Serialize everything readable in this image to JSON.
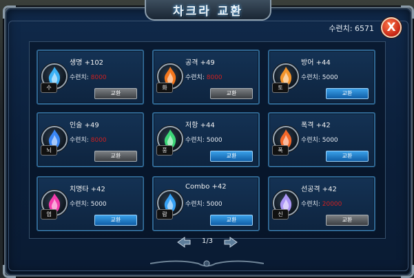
{
  "title": "차크라 교환",
  "points": {
    "label": "수련치:",
    "value": "6571"
  },
  "close_label": "X",
  "cost_label": "수련치:",
  "button_label": "교환",
  "cards": [
    {
      "stat": "생명 +102",
      "cost": "8000",
      "affordable": false,
      "tag": "수",
      "color": "#3db8ff"
    },
    {
      "stat": "공격 +49",
      "cost": "8000",
      "affordable": false,
      "tag": "화",
      "color": "#ff7a1a"
    },
    {
      "stat": "방어 +44",
      "cost": "5000",
      "affordable": true,
      "tag": "토",
      "color": "#ff9a2a"
    },
    {
      "stat": "인술 +49",
      "cost": "8000",
      "affordable": false,
      "tag": "뇌",
      "color": "#3b8bff"
    },
    {
      "stat": "저항 +44",
      "cost": "5000",
      "affordable": true,
      "tag": "풍",
      "color": "#3ee07a"
    },
    {
      "stat": "폭격 +42",
      "cost": "5000",
      "affordable": true,
      "tag": "폭",
      "color": "#ff6a28"
    },
    {
      "stat": "치명타 +42",
      "cost": "5000",
      "affordable": true,
      "tag": "염",
      "color": "#ff3db2"
    },
    {
      "stat": "Combo +42",
      "cost": "5000",
      "affordable": true,
      "tag": "람",
      "color": "#38a8ff"
    },
    {
      "stat": "선공격 +42",
      "cost": "20000",
      "affordable": false,
      "tag": "신",
      "color": "#b39bff"
    }
  ],
  "pager": {
    "label": "1/3"
  }
}
